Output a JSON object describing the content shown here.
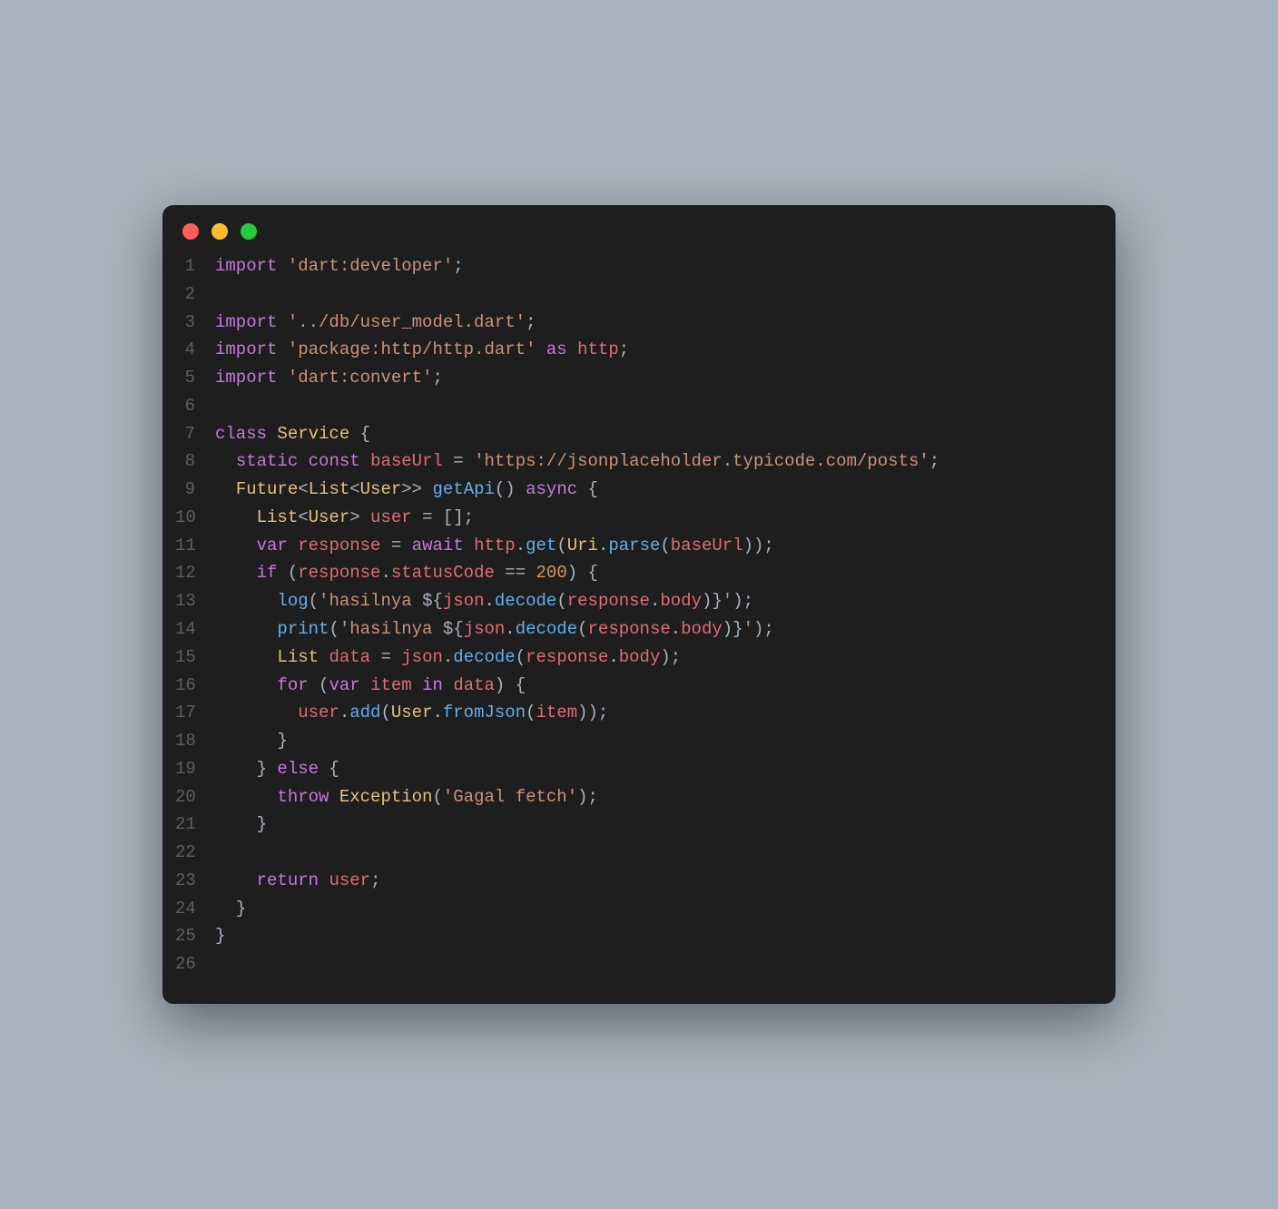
{
  "window": {
    "dots": {
      "red": "#ff5f56",
      "yellow": "#ffbd2e",
      "green": "#27c93f"
    }
  },
  "code": {
    "language": "dart",
    "lines": [
      {
        "n": 1,
        "tokens": [
          [
            "kw",
            "import"
          ],
          [
            "pun",
            " "
          ],
          [
            "str",
            "'dart:developer'"
          ],
          [
            "pun",
            ";"
          ]
        ]
      },
      {
        "n": 2,
        "tokens": []
      },
      {
        "n": 3,
        "tokens": [
          [
            "kw",
            "import"
          ],
          [
            "pun",
            " "
          ],
          [
            "str",
            "'../db/user_model.dart'"
          ],
          [
            "pun",
            ";"
          ]
        ]
      },
      {
        "n": 4,
        "tokens": [
          [
            "kw",
            "import"
          ],
          [
            "pun",
            " "
          ],
          [
            "str",
            "'package:http/http.dart'"
          ],
          [
            "pun",
            " "
          ],
          [
            "kw",
            "as"
          ],
          [
            "pun",
            " "
          ],
          [
            "id",
            "http"
          ],
          [
            "pun",
            ";"
          ]
        ]
      },
      {
        "n": 5,
        "tokens": [
          [
            "kw",
            "import"
          ],
          [
            "pun",
            " "
          ],
          [
            "str",
            "'dart:convert'"
          ],
          [
            "pun",
            ";"
          ]
        ]
      },
      {
        "n": 6,
        "tokens": []
      },
      {
        "n": 7,
        "tokens": [
          [
            "kw",
            "class"
          ],
          [
            "pun",
            " "
          ],
          [
            "typ",
            "Service"
          ],
          [
            "pun",
            " {"
          ]
        ]
      },
      {
        "n": 8,
        "tokens": [
          [
            "pun",
            "  "
          ],
          [
            "kw",
            "static"
          ],
          [
            "pun",
            " "
          ],
          [
            "kw",
            "const"
          ],
          [
            "pun",
            " "
          ],
          [
            "id",
            "baseUrl"
          ],
          [
            "pun",
            " "
          ],
          [
            "op",
            "="
          ],
          [
            "pun",
            " "
          ],
          [
            "str",
            "'https://jsonplaceholder.typicode.com/posts'"
          ],
          [
            "pun",
            ";"
          ]
        ]
      },
      {
        "n": 9,
        "tokens": [
          [
            "pun",
            "  "
          ],
          [
            "typ",
            "Future"
          ],
          [
            "pun",
            "<"
          ],
          [
            "typ",
            "List"
          ],
          [
            "pun",
            "<"
          ],
          [
            "typ",
            "User"
          ],
          [
            "pun",
            ">> "
          ],
          [
            "fn",
            "getApi"
          ],
          [
            "pun",
            "() "
          ],
          [
            "kw",
            "async"
          ],
          [
            "pun",
            " {"
          ]
        ]
      },
      {
        "n": 10,
        "tokens": [
          [
            "pun",
            "    "
          ],
          [
            "typ",
            "List"
          ],
          [
            "pun",
            "<"
          ],
          [
            "typ",
            "User"
          ],
          [
            "pun",
            "> "
          ],
          [
            "id",
            "user"
          ],
          [
            "pun",
            " "
          ],
          [
            "op",
            "="
          ],
          [
            "pun",
            " [];"
          ]
        ]
      },
      {
        "n": 11,
        "tokens": [
          [
            "pun",
            "    "
          ],
          [
            "kw",
            "var"
          ],
          [
            "pun",
            " "
          ],
          [
            "id",
            "response"
          ],
          [
            "pun",
            " "
          ],
          [
            "op",
            "="
          ],
          [
            "pun",
            " "
          ],
          [
            "kw",
            "await"
          ],
          [
            "pun",
            " "
          ],
          [
            "id",
            "http"
          ],
          [
            "pun",
            "."
          ],
          [
            "fn",
            "get"
          ],
          [
            "pun",
            "("
          ],
          [
            "typ",
            "Uri"
          ],
          [
            "pun",
            "."
          ],
          [
            "fn",
            "parse"
          ],
          [
            "pun",
            "("
          ],
          [
            "id",
            "baseUrl"
          ],
          [
            "pun",
            "));"
          ]
        ]
      },
      {
        "n": 12,
        "tokens": [
          [
            "pun",
            "    "
          ],
          [
            "kw",
            "if"
          ],
          [
            "pun",
            " ("
          ],
          [
            "id",
            "response"
          ],
          [
            "pun",
            "."
          ],
          [
            "id",
            "statusCode"
          ],
          [
            "pun",
            " "
          ],
          [
            "op",
            "=="
          ],
          [
            "pun",
            " "
          ],
          [
            "num",
            "200"
          ],
          [
            "pun",
            ") {"
          ]
        ]
      },
      {
        "n": 13,
        "tokens": [
          [
            "pun",
            "      "
          ],
          [
            "fn",
            "log"
          ],
          [
            "pun",
            "("
          ],
          [
            "str",
            "'hasilnya "
          ],
          [
            "pun",
            "${"
          ],
          [
            "id",
            "json"
          ],
          [
            "pun",
            "."
          ],
          [
            "fn",
            "decode"
          ],
          [
            "pun",
            "("
          ],
          [
            "id",
            "response"
          ],
          [
            "pun",
            "."
          ],
          [
            "id",
            "body"
          ],
          [
            "pun",
            ")}"
          ],
          [
            "str",
            "'"
          ],
          [
            "pun",
            ");"
          ]
        ]
      },
      {
        "n": 14,
        "tokens": [
          [
            "pun",
            "      "
          ],
          [
            "fn",
            "print"
          ],
          [
            "pun",
            "("
          ],
          [
            "str",
            "'hasilnya "
          ],
          [
            "pun",
            "${"
          ],
          [
            "id",
            "json"
          ],
          [
            "pun",
            "."
          ],
          [
            "fn",
            "decode"
          ],
          [
            "pun",
            "("
          ],
          [
            "id",
            "response"
          ],
          [
            "pun",
            "."
          ],
          [
            "id",
            "body"
          ],
          [
            "pun",
            ")}"
          ],
          [
            "str",
            "'"
          ],
          [
            "pun",
            ");"
          ]
        ]
      },
      {
        "n": 15,
        "tokens": [
          [
            "pun",
            "      "
          ],
          [
            "typ",
            "List"
          ],
          [
            "pun",
            " "
          ],
          [
            "id",
            "data"
          ],
          [
            "pun",
            " "
          ],
          [
            "op",
            "="
          ],
          [
            "pun",
            " "
          ],
          [
            "id",
            "json"
          ],
          [
            "pun",
            "."
          ],
          [
            "fn",
            "decode"
          ],
          [
            "pun",
            "("
          ],
          [
            "id",
            "response"
          ],
          [
            "pun",
            "."
          ],
          [
            "id",
            "body"
          ],
          [
            "pun",
            ");"
          ]
        ]
      },
      {
        "n": 16,
        "tokens": [
          [
            "pun",
            "      "
          ],
          [
            "kw",
            "for"
          ],
          [
            "pun",
            " ("
          ],
          [
            "kw",
            "var"
          ],
          [
            "pun",
            " "
          ],
          [
            "id",
            "item"
          ],
          [
            "pun",
            " "
          ],
          [
            "kw",
            "in"
          ],
          [
            "pun",
            " "
          ],
          [
            "id",
            "data"
          ],
          [
            "pun",
            ") {"
          ]
        ]
      },
      {
        "n": 17,
        "tokens": [
          [
            "pun",
            "        "
          ],
          [
            "id",
            "user"
          ],
          [
            "pun",
            "."
          ],
          [
            "fn",
            "add"
          ],
          [
            "pun",
            "("
          ],
          [
            "typ",
            "User"
          ],
          [
            "pun",
            "."
          ],
          [
            "fn",
            "fromJson"
          ],
          [
            "pun",
            "("
          ],
          [
            "id",
            "item"
          ],
          [
            "pun",
            "));"
          ]
        ]
      },
      {
        "n": 18,
        "tokens": [
          [
            "pun",
            "      }"
          ]
        ]
      },
      {
        "n": 19,
        "tokens": [
          [
            "pun",
            "    } "
          ],
          [
            "kw",
            "else"
          ],
          [
            "pun",
            " {"
          ]
        ]
      },
      {
        "n": 20,
        "tokens": [
          [
            "pun",
            "      "
          ],
          [
            "kw",
            "throw"
          ],
          [
            "pun",
            " "
          ],
          [
            "typ",
            "Exception"
          ],
          [
            "pun",
            "("
          ],
          [
            "str",
            "'Gagal fetch'"
          ],
          [
            "pun",
            ");"
          ]
        ]
      },
      {
        "n": 21,
        "tokens": [
          [
            "pun",
            "    }"
          ]
        ]
      },
      {
        "n": 22,
        "tokens": []
      },
      {
        "n": 23,
        "tokens": [
          [
            "pun",
            "    "
          ],
          [
            "kw",
            "return"
          ],
          [
            "pun",
            " "
          ],
          [
            "id",
            "user"
          ],
          [
            "pun",
            ";"
          ]
        ]
      },
      {
        "n": 24,
        "tokens": [
          [
            "pun",
            "  }"
          ]
        ]
      },
      {
        "n": 25,
        "tokens": [
          [
            "pun",
            "}"
          ]
        ]
      },
      {
        "n": 26,
        "tokens": []
      }
    ]
  }
}
